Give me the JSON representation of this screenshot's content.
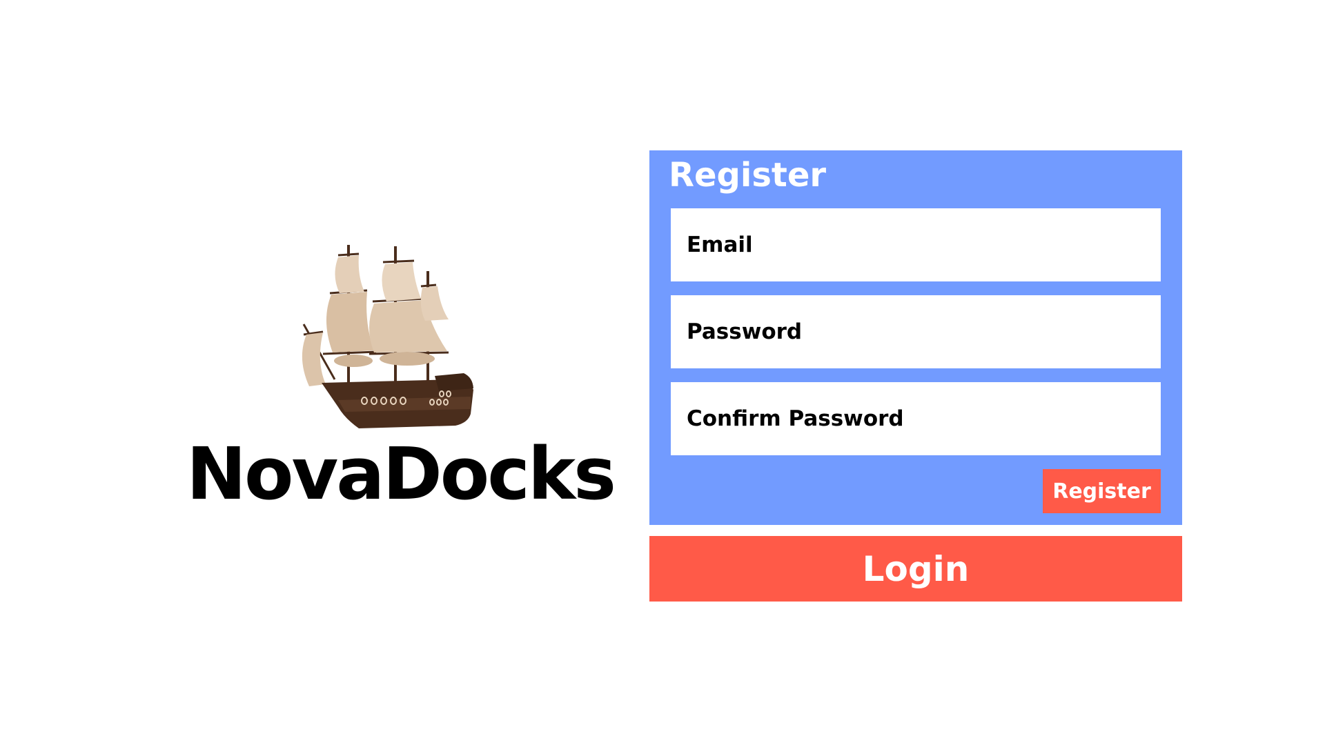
{
  "brand": {
    "name": "NovaDocks",
    "logo_icon": "sailing-ship-icon"
  },
  "register": {
    "title": "Register",
    "fields": {
      "email_label": "Email",
      "password_label": "Password",
      "confirm_password_label": "Confirm Password"
    },
    "submit_label": "Register"
  },
  "login": {
    "label": "Login"
  },
  "colors": {
    "panel_background": "#729bff",
    "accent_button": "#ff5a48",
    "field_background": "#ffffff",
    "text_dark": "#000000",
    "text_light": "#ffffff"
  }
}
